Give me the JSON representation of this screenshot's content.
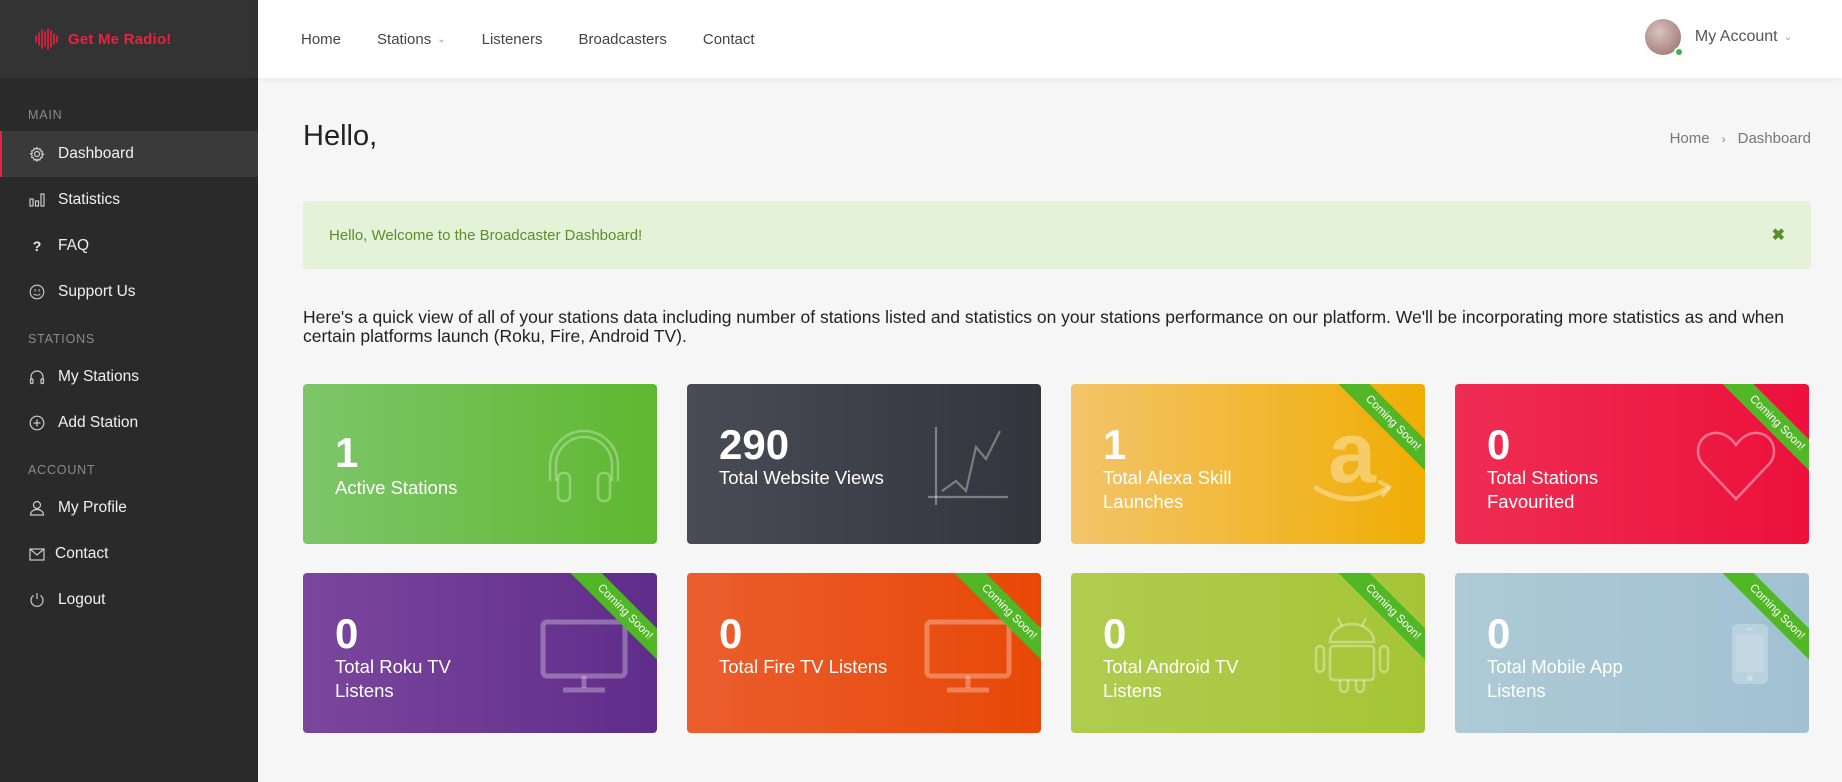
{
  "brand": {
    "name": "Get Me Radio!",
    "color": "#e8223f"
  },
  "sidebar": {
    "sections": [
      {
        "label": "MAIN",
        "items": [
          {
            "label": "Dashboard",
            "icon": "gear-icon",
            "active": true
          },
          {
            "label": "Statistics",
            "icon": "bar-chart-icon"
          },
          {
            "label": "FAQ",
            "icon": "question-icon"
          },
          {
            "label": "Support Us",
            "icon": "smiley-icon"
          }
        ]
      },
      {
        "label": "STATIONS",
        "items": [
          {
            "label": "My Stations",
            "icon": "headphones-icon"
          },
          {
            "label": "Add Station",
            "icon": "plus-circle-icon"
          }
        ]
      },
      {
        "label": "ACCOUNT",
        "items": [
          {
            "label": "My Profile",
            "icon": "user-icon"
          },
          {
            "label": "Contact",
            "icon": "envelope-icon"
          },
          {
            "label": "Logout",
            "icon": "power-icon"
          }
        ]
      }
    ]
  },
  "topnav": {
    "items": [
      {
        "label": "Home"
      },
      {
        "label": "Stations",
        "dropdown": true
      },
      {
        "label": "Listeners"
      },
      {
        "label": "Broadcasters"
      },
      {
        "label": "Contact"
      }
    ],
    "account": {
      "label": "My Account",
      "status": "online"
    }
  },
  "page": {
    "title": "Hello,",
    "breadcrumb": [
      "Home",
      "Dashboard"
    ],
    "alert": {
      "text": "Hello, Welcome to the Broadcaster Dashboard!",
      "close": "✖"
    },
    "intro": "Here's a quick view of all of your stations data including number of stations listed and statistics on your stations performance on our platform. We'll be incorporating more statistics as and when certain platforms launch (Roku, Fire, Android TV)."
  },
  "cards": [
    {
      "value": "1",
      "label": "Active Stations",
      "icon": "headphones-icon",
      "color": "#5eb82f",
      "coming_soon": false
    },
    {
      "value": "290",
      "label": "Total Website Views",
      "icon": "line-chart-icon",
      "color": "#33353d",
      "coming_soon": false
    },
    {
      "value": "1",
      "label": "Total Alexa Skill Launches",
      "icon": "amazon-icon",
      "color": "#f0ad04",
      "coming_soon": true
    },
    {
      "value": "0",
      "label": "Total Stations Favourited",
      "icon": "heart-icon",
      "color": "#ec113c",
      "coming_soon": true
    },
    {
      "value": "0",
      "label": "Total Roku TV Listens",
      "icon": "tv-icon",
      "color": "#5f2d8a",
      "coming_soon": true
    },
    {
      "value": "0",
      "label": "Total Fire TV Listens",
      "icon": "tv-icon",
      "color": "#e84807",
      "coming_soon": true
    },
    {
      "value": "0",
      "label": "Total Android TV Listens",
      "icon": "android-icon",
      "color": "#a5c536",
      "coming_soon": true
    },
    {
      "value": "0",
      "label": "Total Mobile App Listens",
      "icon": "mobile-phone-icon",
      "color": "#a1c1d3",
      "coming_soon": true
    }
  ],
  "ribbon_text": "Coming Soon!"
}
